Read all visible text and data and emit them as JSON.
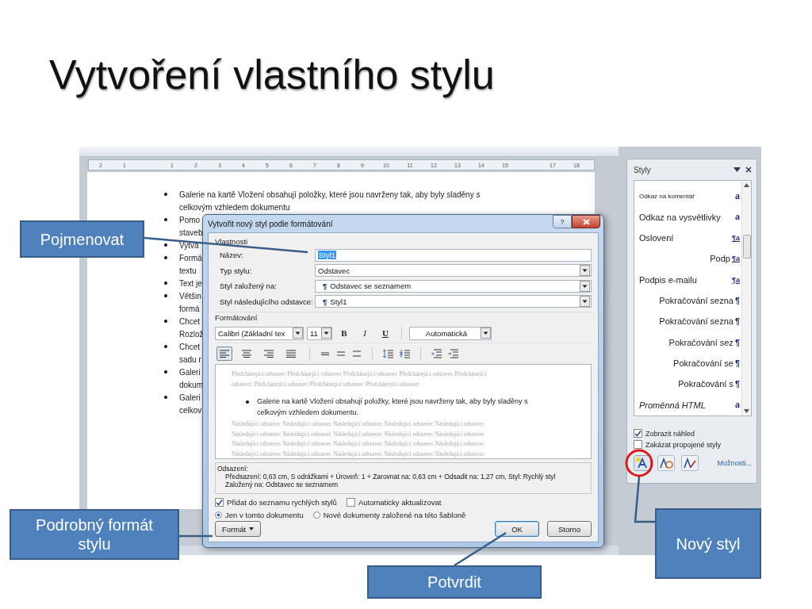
{
  "title": "Vytvoření vlastního stylu",
  "ruler": [
    "2",
    "1",
    "1",
    "2",
    "3",
    "4",
    "5",
    "6",
    "7",
    "8",
    "9",
    "10",
    "11",
    "12",
    "13",
    "14",
    "15",
    "17",
    "18"
  ],
  "document": {
    "lines": [
      {
        "text": "Galerie na kartě Vložení obsahují položky, které jsou navrženy tak, aby byly sladěny s",
        "bullet": true
      },
      {
        "text": "celkovým vzhledem dokumentu",
        "bullet": false
      },
      {
        "text": "Pomo",
        "bullet": true
      },
      {
        "text": "staveb",
        "bullet": false
      },
      {
        "text": "Vytvá",
        "bullet": true
      },
      {
        "text": "Formá",
        "bullet": true
      },
      {
        "text": "textu",
        "bullet": false
      },
      {
        "text": "Text je",
        "bullet": true
      },
      {
        "text": "Většin",
        "bullet": true
      },
      {
        "text": "formá",
        "bullet": false
      },
      {
        "text": "Chcet",
        "bullet": true
      },
      {
        "text": "Rozlož",
        "bullet": false
      },
      {
        "text": "Chcet",
        "bullet": true
      },
      {
        "text": "sadu r",
        "bullet": false
      },
      {
        "text": "Galeri",
        "bullet": true
      },
      {
        "text": "dokum",
        "bullet": false
      },
      {
        "text": "Galeri",
        "bullet": true
      },
      {
        "text": "celkov",
        "bullet": false
      }
    ]
  },
  "dialog": {
    "title": "Vytvořit nový styl podle formátování",
    "help": "?",
    "properties_label": "Vlastnosti",
    "fields": [
      {
        "label": "Název:",
        "kind": "text",
        "value": "Styl1",
        "highlighted": true
      },
      {
        "label": "Typ stylu:",
        "kind": "dropdown",
        "value": "Odstavec"
      },
      {
        "label": "Styl založený na:",
        "kind": "dropdown",
        "mark": "¶",
        "value": "Odstavec se seznamem"
      },
      {
        "label": "Styl následujícího odstavce:",
        "kind": "dropdown",
        "mark": "¶",
        "value": "Styl1"
      }
    ],
    "formatting_label": "Formátování",
    "font": "Calibri (Základní tex",
    "size": "11",
    "bold": "B",
    "italic": "I",
    "underline": "U",
    "colour_option": "Automatická",
    "align_buttons": [
      {
        "selected": true
      },
      {
        "selected": false
      },
      {
        "selected": false
      },
      {
        "selected": false
      }
    ],
    "preview": {
      "previous": [
        "Předcházející odstavec Předcházející odstavec Předcházející odstavec Předcházející odstavec Předcházející",
        "odstavec Předcházející odstavec Předcházející odstavec Předcházející odstavec"
      ],
      "sample": "Galerie na kartě Vložení obsahují položky, které jsou navrženy tak, aby byly sladěny s celkovým vzhledem dokumentu.",
      "following": [
        "Následující odstavec Následující odstavec Následující odstavec Následující odstavec Následující odstavec",
        "Následující odstavec Následující odstavec Následující odstavec Následující odstavec Následující odstavec",
        "Následující odstavec Následující odstavec Následující odstavec Následující odstavec Následující odstavec",
        "Následující odstavec Následující odstavec Následující odstavec Následující odstavec Následující odstavec"
      ]
    },
    "description": [
      "Odsazení:",
      "Předsazení:  0,63 cm, S odrážkami + Úroveň: 1 + Zarovnat na:  0,63 cm + Odsadit na:  1,27 cm, Styl: Rychlý styl",
      "Založený na: Odstavec se seznamem"
    ],
    "checkboxes": [
      {
        "label": "Přidat do seznamu rychlých stylů",
        "checked": true
      },
      {
        "label": "Automaticky aktualizovat",
        "checked": false
      }
    ],
    "radios": [
      {
        "label": "Jen v tomto dokumentu",
        "selected": true
      },
      {
        "label": "Nové dokumenty založené na této šabloně",
        "selected": false
      }
    ],
    "format_button": "Formát",
    "ok_button": "OK",
    "cancel_button": "Storno"
  },
  "styles_pane": {
    "title": "Styly",
    "items": [
      {
        "name": "Odkaz na komentář",
        "small": true,
        "indented": false,
        "italic": false,
        "kind": "character",
        "mark": "a"
      },
      {
        "name": "Odkaz na vysvětlivky",
        "small": false,
        "indented": false,
        "italic": false,
        "kind": "character",
        "mark": "a"
      },
      {
        "name": "Oslovení",
        "small": false,
        "indented": false,
        "italic": false,
        "kind": "linked",
        "mark": "¶a"
      },
      {
        "name": "Podp",
        "small": false,
        "indented": true,
        "italic": false,
        "kind": "linked",
        "mark": "¶a"
      },
      {
        "name": "Podpis e-mailu",
        "small": false,
        "indented": false,
        "italic": false,
        "kind": "linked",
        "mark": "¶a"
      },
      {
        "name": "Pokračování sezna",
        "small": false,
        "indented": true,
        "italic": false,
        "kind": "paragraph",
        "mark": "¶"
      },
      {
        "name": "Pokračování sezna",
        "small": false,
        "indented": true,
        "italic": false,
        "kind": "paragraph",
        "mark": "¶"
      },
      {
        "name": "Pokračování sez",
        "small": false,
        "indented": true,
        "italic": false,
        "kind": "paragraph",
        "mark": "¶"
      },
      {
        "name": "Pokračování se",
        "small": false,
        "indented": true,
        "italic": false,
        "kind": "paragraph",
        "mark": "¶"
      },
      {
        "name": "Pokračování s",
        "small": false,
        "indented": true,
        "italic": false,
        "kind": "paragraph",
        "mark": "¶"
      },
      {
        "name": "Proměnná HTML",
        "small": false,
        "indented": false,
        "italic": true,
        "kind": "character",
        "mark": "a"
      }
    ],
    "checkboxes": [
      {
        "label": "Zobrazit náhled",
        "checked": true
      },
      {
        "label": "Zakázat propojené styly",
        "checked": false
      }
    ],
    "options_link": "Možnosti..."
  },
  "callouts": [
    {
      "text": "Pojmenovat"
    },
    {
      "text": "Podrobný formát stylu"
    },
    {
      "text": "Potvrdit"
    },
    {
      "text": "Nový styl"
    }
  ]
}
